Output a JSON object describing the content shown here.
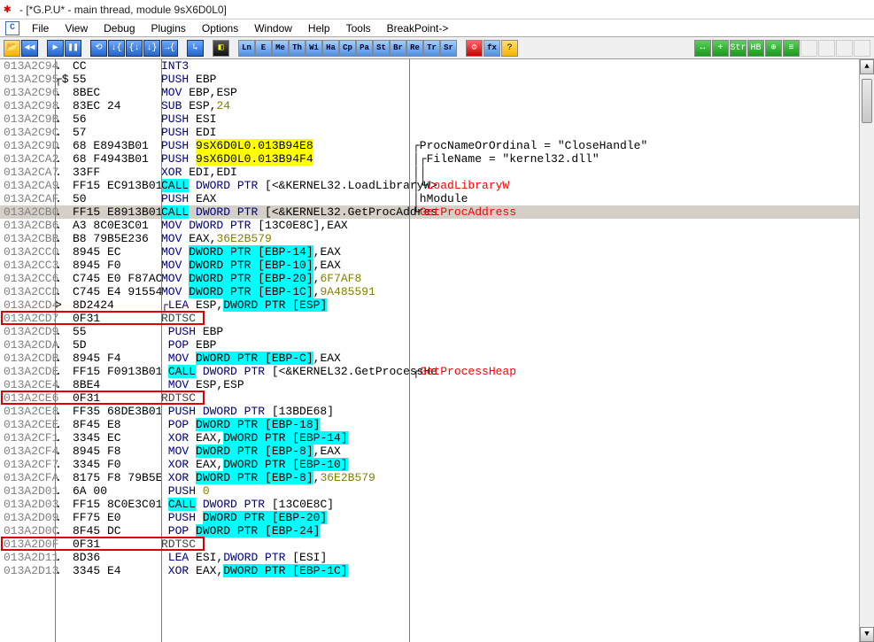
{
  "title": "- [*G.P.U* - main thread, module 9sX6D0L0]",
  "menu": {
    "c": "C",
    "items": [
      "File",
      "View",
      "Debug",
      "Plugins",
      "Options",
      "Window",
      "Help",
      "Tools",
      "BreakPoint->"
    ]
  },
  "tb": {
    "open": "📂",
    "rew": "◀◀",
    "play": "▶",
    "pause": "❚❚",
    "b1": "⟲",
    "b2": "↓{",
    "b3": "{↓",
    "b4": "↓}",
    "b5": "→{",
    "into": "↳",
    "cube": "◧",
    "regs": [
      "Ln",
      "E",
      "Me",
      "Th",
      "Wi",
      "Ha",
      "Cp",
      "Pa",
      "St",
      "Br",
      "Re",
      "Tr",
      "Sr"
    ],
    "gear": "⚙",
    "fx": "fx",
    "help": "?",
    "r1": "↔",
    "r2": "+",
    "r3": "Str",
    "r4": "HB",
    "r5": "⊕",
    "r6": "≡"
  },
  "rows": [
    {
      "a": "013A2C94",
      "m": ".",
      "h": "CC",
      "d": [
        [
          "INT3",
          "kw"
        ]
      ]
    },
    {
      "a": "013A2C95",
      "m": "┌$",
      "h": "55",
      "d": [
        [
          "PUSH ",
          "kw"
        ],
        [
          "EBP",
          ""
        ]
      ]
    },
    {
      "a": "013A2C96",
      "m": ".",
      "h": "8BEC",
      "d": [
        [
          "MOV ",
          "kw"
        ],
        [
          "EBP",
          ""
        ],
        [
          ",",
          ""
        ],
        [
          "ESP",
          ""
        ]
      ]
    },
    {
      "a": "013A2C98",
      "m": ".",
      "h": "83EC 24",
      "d": [
        [
          "SUB ",
          "kw"
        ],
        [
          "ESP",
          ""
        ],
        [
          ",",
          ""
        ],
        [
          "24",
          "num"
        ]
      ]
    },
    {
      "a": "013A2C9B",
      "m": ".",
      "h": "56",
      "d": [
        [
          "PUSH ",
          "kw"
        ],
        [
          "ESI",
          ""
        ]
      ]
    },
    {
      "a": "013A2C9C",
      "m": ".",
      "h": "57",
      "d": [
        [
          "PUSH ",
          "kw"
        ],
        [
          "EDI",
          ""
        ]
      ]
    },
    {
      "a": "013A2C9D",
      "m": ".",
      "h": "68 E8943B01",
      "d": [
        [
          "PUSH ",
          "kw"
        ],
        [
          "9sX6D0L0.013B94E8",
          "hl-yel"
        ]
      ],
      "c": [
        [
          "┌ProcNameOrOrdinal = \"CloseHandle\"",
          "cmt-blk"
        ]
      ]
    },
    {
      "a": "013A2CA2",
      "m": ".",
      "h": "68 F4943B01",
      "d": [
        [
          "PUSH ",
          "kw"
        ],
        [
          "9sX6D0L0.013B94F4",
          "hl-yel"
        ]
      ],
      "c": [
        [
          "│┌FileName = \"kernel32.dll\"",
          "cmt-blk"
        ]
      ]
    },
    {
      "a": "013A2CA7",
      "m": ".",
      "h": "33FF",
      "d": [
        [
          "XOR ",
          "kw"
        ],
        [
          "EDI",
          ""
        ],
        [
          ",",
          ""
        ],
        [
          "EDI",
          ""
        ]
      ],
      "c": [
        [
          "││",
          "cmt-blk"
        ]
      ]
    },
    {
      "a": "013A2CA9",
      "m": ".",
      "h": "FF15 EC913B01",
      "d": [
        [
          "CALL",
          "hl-cyan"
        ],
        [
          " ",
          ""
        ],
        [
          "DWORD PTR ",
          "kw"
        ],
        [
          "[<&KERNEL32.LoadLibraryW>",
          ""
        ]
      ],
      "c": [
        [
          "│└",
          "cmt-blk"
        ],
        [
          "LoadLibraryW",
          "cmt-red"
        ]
      ]
    },
    {
      "a": "013A2CAF",
      "m": ".",
      "h": "50",
      "d": [
        [
          "PUSH ",
          "kw"
        ],
        [
          "EAX",
          ""
        ]
      ],
      "c": [
        [
          "│hModule",
          "cmt-blk"
        ]
      ]
    },
    {
      "a": "013A2CB0",
      "m": ".",
      "h": "FF15 E8913B01",
      "g": 1,
      "d": [
        [
          "CALL",
          "hl-cyan"
        ],
        [
          " ",
          ""
        ],
        [
          "DWORD PTR ",
          "kw"
        ],
        [
          "[<&KERNEL32.GetProcAddres",
          ""
        ]
      ],
      "c": [
        [
          "└",
          "cmt-blk"
        ],
        [
          "GetProcAddress",
          "cmt-red"
        ]
      ]
    },
    {
      "a": "013A2CB6",
      "m": ".",
      "h": "A3 8C0E3C01",
      "d": [
        [
          "MOV ",
          "kw"
        ],
        [
          "DWORD PTR ",
          "kw"
        ],
        [
          "[13C0E8C]",
          ""
        ],
        [
          ",",
          ""
        ],
        [
          "EAX",
          ""
        ]
      ]
    },
    {
      "a": "013A2CBB",
      "m": ".",
      "h": "B8 79B5E236",
      "d": [
        [
          "MOV ",
          "kw"
        ],
        [
          "EAX",
          ""
        ],
        [
          ",",
          ""
        ],
        [
          "36E2B579",
          "num"
        ]
      ]
    },
    {
      "a": "013A2CC0",
      "m": ".",
      "h": "8945 EC",
      "d": [
        [
          "MOV ",
          "kw"
        ],
        [
          "DWORD PTR [EBP-14]",
          "hl-cyan"
        ],
        [
          ",",
          ""
        ],
        [
          "EAX",
          ""
        ]
      ]
    },
    {
      "a": "013A2CC3",
      "m": ".",
      "h": "8945 F0",
      "d": [
        [
          "MOV ",
          "kw"
        ],
        [
          "DWORD PTR [EBP-10]",
          "hl-cyan"
        ],
        [
          ",",
          ""
        ],
        [
          "EAX",
          ""
        ]
      ]
    },
    {
      "a": "013A2CC6",
      "m": ".",
      "h": "C745 E0 F87AC",
      "d": [
        [
          "MOV ",
          "kw"
        ],
        [
          "DWORD PTR [EBP-20]",
          "hl-cyan"
        ],
        [
          ",",
          ""
        ],
        [
          "6F7AF8",
          "num"
        ]
      ]
    },
    {
      "a": "013A2CCD",
      "m": ".",
      "h": "C745 E4 91554",
      "d": [
        [
          "MOV ",
          "kw"
        ],
        [
          "DWORD PTR [EBP-1C]",
          "hl-cyan"
        ],
        [
          ",",
          ""
        ],
        [
          "9A485591",
          "num"
        ]
      ]
    },
    {
      "a": "013A2CD4",
      "m": ">",
      "h": "8D2424",
      "d": [
        [
          "┌LEA ",
          "kw"
        ],
        [
          "ESP",
          ""
        ],
        [
          ",",
          ""
        ],
        [
          "DWORD PTR [ESP]",
          "hl-cyan"
        ]
      ]
    },
    {
      "a": "013A2CD7",
      "m": "",
      "h": "0F31",
      "box": 1,
      "d": [
        [
          "RDTSC",
          "reg"
        ]
      ]
    },
    {
      "a": "013A2CD9",
      "m": ".",
      "h": "55",
      "d": [
        [
          " PUSH ",
          "kw"
        ],
        [
          "EBP",
          ""
        ]
      ]
    },
    {
      "a": "013A2CDA",
      "m": ".",
      "h": "5D",
      "d": [
        [
          " POP ",
          "kw"
        ],
        [
          "EBP",
          ""
        ]
      ]
    },
    {
      "a": "013A2CDB",
      "m": ".",
      "h": "8945 F4",
      "d": [
        [
          " MOV ",
          "kw"
        ],
        [
          "DWORD PTR [EBP-C]",
          "hl-cyan"
        ],
        [
          ",",
          ""
        ],
        [
          "EAX",
          ""
        ]
      ]
    },
    {
      "a": "013A2CDE",
      "m": ".",
      "h": "FF15 F0913B01",
      "d": [
        [
          " ",
          ""
        ],
        [
          "CALL",
          "hl-cyan"
        ],
        [
          " ",
          ""
        ],
        [
          "DWORD PTR ",
          "kw"
        ],
        [
          "[<&KERNEL32.GetProcessHe",
          ""
        ]
      ],
      "c": [
        [
          "┌",
          "cmt-blk"
        ],
        [
          "GetProcessHeap",
          "cmt-red"
        ]
      ]
    },
    {
      "a": "013A2CE4",
      "m": ".",
      "h": "8BE4",
      "d": [
        [
          " MOV ",
          "kw"
        ],
        [
          "ESP",
          ""
        ],
        [
          ",",
          ""
        ],
        [
          "ESP",
          ""
        ]
      ]
    },
    {
      "a": "013A2CE6",
      "m": "",
      "h": "0F31",
      "box": 1,
      "d": [
        [
          "RDTSC",
          "reg"
        ]
      ]
    },
    {
      "a": "013A2CE8",
      "m": ".",
      "h": "FF35 68DE3B01",
      "d": [
        [
          " PUSH ",
          "kw"
        ],
        [
          "DWORD PTR ",
          "kw"
        ],
        [
          "[13BDE68]",
          ""
        ]
      ]
    },
    {
      "a": "013A2CEE",
      "m": ".",
      "h": "8F45 E8",
      "d": [
        [
          " POP ",
          "kw"
        ],
        [
          "DWORD PTR [EBP-18]",
          "hl-cyan"
        ]
      ]
    },
    {
      "a": "013A2CF1",
      "m": ".",
      "h": "3345 EC",
      "d": [
        [
          " XOR ",
          "kw"
        ],
        [
          "EAX",
          ""
        ],
        [
          ",",
          ""
        ],
        [
          "DWORD PTR [EBP-14]",
          "hl-cyan"
        ]
      ]
    },
    {
      "a": "013A2CF4",
      "m": ".",
      "h": "8945 F8",
      "d": [
        [
          " MOV ",
          "kw"
        ],
        [
          "DWORD PTR [EBP-8]",
          "hl-cyan"
        ],
        [
          ",",
          ""
        ],
        [
          "EAX",
          ""
        ]
      ]
    },
    {
      "a": "013A2CF7",
      "m": ".",
      "h": "3345 F0",
      "d": [
        [
          " XOR ",
          "kw"
        ],
        [
          "EAX",
          ""
        ],
        [
          ",",
          ""
        ],
        [
          "DWORD PTR [EBP-10]",
          "hl-cyan"
        ]
      ]
    },
    {
      "a": "013A2CFA",
      "m": ".",
      "h": "8175 F8 79B5E",
      "d": [
        [
          " XOR ",
          "kw"
        ],
        [
          "DWORD PTR [EBP-8]",
          "hl-cyan"
        ],
        [
          ",",
          ""
        ],
        [
          "36E2B579",
          "num"
        ]
      ]
    },
    {
      "a": "013A2D01",
      "m": ".",
      "h": "6A 00",
      "d": [
        [
          " PUSH ",
          "kw"
        ],
        [
          "0",
          "num"
        ]
      ]
    },
    {
      "a": "013A2D03",
      "m": ".",
      "h": "FF15 8C0E3C01",
      "d": [
        [
          " ",
          ""
        ],
        [
          "CALL",
          "hl-cyan"
        ],
        [
          " ",
          ""
        ],
        [
          "DWORD PTR ",
          "kw"
        ],
        [
          "[13C0E8C]",
          ""
        ]
      ]
    },
    {
      "a": "013A2D09",
      "m": ".",
      "h": "FF75 E0",
      "d": [
        [
          " PUSH ",
          "kw"
        ],
        [
          "DWORD PTR [EBP-20]",
          "hl-cyan"
        ]
      ]
    },
    {
      "a": "013A2D0C",
      "m": ".",
      "h": "8F45 DC",
      "d": [
        [
          " POP ",
          "kw"
        ],
        [
          "DWORD PTR [EBP-24]",
          "hl-cyan"
        ]
      ]
    },
    {
      "a": "013A2D0F",
      "m": "",
      "h": "0F31",
      "box": 1,
      "d": [
        [
          "RDTSC",
          "reg"
        ]
      ]
    },
    {
      "a": "013A2D11",
      "m": ".",
      "h": "8D36",
      "d": [
        [
          " LEA ",
          "kw"
        ],
        [
          "ESI",
          ""
        ],
        [
          ",",
          ""
        ],
        [
          "DWORD PTR ",
          "kw"
        ],
        [
          "[ESI]",
          ""
        ]
      ]
    },
    {
      "a": "013A2D13",
      "m": ".",
      "h": "3345 E4",
      "d": [
        [
          " XOR ",
          "kw"
        ],
        [
          "EAX",
          ""
        ],
        [
          ",",
          ""
        ],
        [
          "DWORD PTR [EBP-1C]",
          "hl-cyan"
        ]
      ]
    }
  ]
}
